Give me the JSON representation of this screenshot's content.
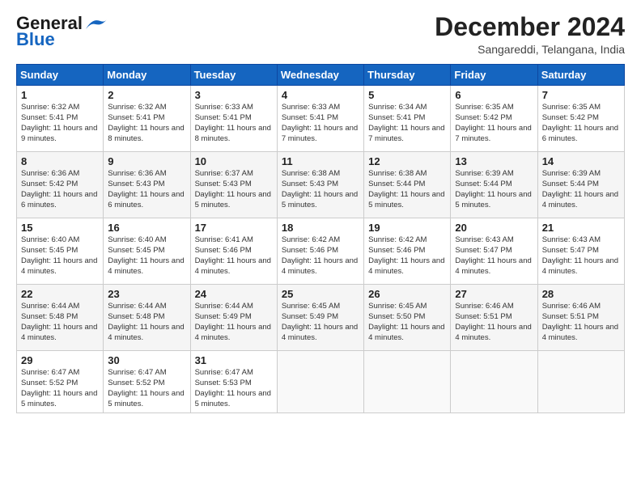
{
  "logo": {
    "line1": "General",
    "line2": "Blue"
  },
  "title": "December 2024",
  "location": "Sangareddi, Telangana, India",
  "days_of_week": [
    "Sunday",
    "Monday",
    "Tuesday",
    "Wednesday",
    "Thursday",
    "Friday",
    "Saturday"
  ],
  "weeks": [
    [
      {
        "day": 1,
        "sunrise": "6:32 AM",
        "sunset": "5:41 PM",
        "daylight": "11 hours and 9 minutes."
      },
      {
        "day": 2,
        "sunrise": "6:32 AM",
        "sunset": "5:41 PM",
        "daylight": "11 hours and 8 minutes."
      },
      {
        "day": 3,
        "sunrise": "6:33 AM",
        "sunset": "5:41 PM",
        "daylight": "11 hours and 8 minutes."
      },
      {
        "day": 4,
        "sunrise": "6:33 AM",
        "sunset": "5:41 PM",
        "daylight": "11 hours and 7 minutes."
      },
      {
        "day": 5,
        "sunrise": "6:34 AM",
        "sunset": "5:41 PM",
        "daylight": "11 hours and 7 minutes."
      },
      {
        "day": 6,
        "sunrise": "6:35 AM",
        "sunset": "5:42 PM",
        "daylight": "11 hours and 7 minutes."
      },
      {
        "day": 7,
        "sunrise": "6:35 AM",
        "sunset": "5:42 PM",
        "daylight": "11 hours and 6 minutes."
      }
    ],
    [
      {
        "day": 8,
        "sunrise": "6:36 AM",
        "sunset": "5:42 PM",
        "daylight": "11 hours and 6 minutes."
      },
      {
        "day": 9,
        "sunrise": "6:36 AM",
        "sunset": "5:43 PM",
        "daylight": "11 hours and 6 minutes."
      },
      {
        "day": 10,
        "sunrise": "6:37 AM",
        "sunset": "5:43 PM",
        "daylight": "11 hours and 5 minutes."
      },
      {
        "day": 11,
        "sunrise": "6:38 AM",
        "sunset": "5:43 PM",
        "daylight": "11 hours and 5 minutes."
      },
      {
        "day": 12,
        "sunrise": "6:38 AM",
        "sunset": "5:44 PM",
        "daylight": "11 hours and 5 minutes."
      },
      {
        "day": 13,
        "sunrise": "6:39 AM",
        "sunset": "5:44 PM",
        "daylight": "11 hours and 5 minutes."
      },
      {
        "day": 14,
        "sunrise": "6:39 AM",
        "sunset": "5:44 PM",
        "daylight": "11 hours and 4 minutes."
      }
    ],
    [
      {
        "day": 15,
        "sunrise": "6:40 AM",
        "sunset": "5:45 PM",
        "daylight": "11 hours and 4 minutes."
      },
      {
        "day": 16,
        "sunrise": "6:40 AM",
        "sunset": "5:45 PM",
        "daylight": "11 hours and 4 minutes."
      },
      {
        "day": 17,
        "sunrise": "6:41 AM",
        "sunset": "5:46 PM",
        "daylight": "11 hours and 4 minutes."
      },
      {
        "day": 18,
        "sunrise": "6:42 AM",
        "sunset": "5:46 PM",
        "daylight": "11 hours and 4 minutes."
      },
      {
        "day": 19,
        "sunrise": "6:42 AM",
        "sunset": "5:46 PM",
        "daylight": "11 hours and 4 minutes."
      },
      {
        "day": 20,
        "sunrise": "6:43 AM",
        "sunset": "5:47 PM",
        "daylight": "11 hours and 4 minutes."
      },
      {
        "day": 21,
        "sunrise": "6:43 AM",
        "sunset": "5:47 PM",
        "daylight": "11 hours and 4 minutes."
      }
    ],
    [
      {
        "day": 22,
        "sunrise": "6:44 AM",
        "sunset": "5:48 PM",
        "daylight": "11 hours and 4 minutes."
      },
      {
        "day": 23,
        "sunrise": "6:44 AM",
        "sunset": "5:48 PM",
        "daylight": "11 hours and 4 minutes."
      },
      {
        "day": 24,
        "sunrise": "6:44 AM",
        "sunset": "5:49 PM",
        "daylight": "11 hours and 4 minutes."
      },
      {
        "day": 25,
        "sunrise": "6:45 AM",
        "sunset": "5:49 PM",
        "daylight": "11 hours and 4 minutes."
      },
      {
        "day": 26,
        "sunrise": "6:45 AM",
        "sunset": "5:50 PM",
        "daylight": "11 hours and 4 minutes."
      },
      {
        "day": 27,
        "sunrise": "6:46 AM",
        "sunset": "5:51 PM",
        "daylight": "11 hours and 4 minutes."
      },
      {
        "day": 28,
        "sunrise": "6:46 AM",
        "sunset": "5:51 PM",
        "daylight": "11 hours and 4 minutes."
      }
    ],
    [
      {
        "day": 29,
        "sunrise": "6:47 AM",
        "sunset": "5:52 PM",
        "daylight": "11 hours and 5 minutes."
      },
      {
        "day": 30,
        "sunrise": "6:47 AM",
        "sunset": "5:52 PM",
        "daylight": "11 hours and 5 minutes."
      },
      {
        "day": 31,
        "sunrise": "6:47 AM",
        "sunset": "5:53 PM",
        "daylight": "11 hours and 5 minutes."
      },
      null,
      null,
      null,
      null
    ]
  ],
  "labels": {
    "sunrise": "Sunrise:",
    "sunset": "Sunset:",
    "daylight": "Daylight:"
  }
}
